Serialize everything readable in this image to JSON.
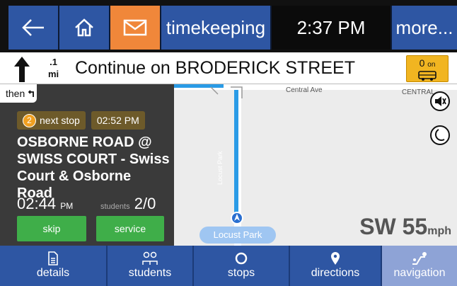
{
  "topbar": {
    "timekeeping": "timekeeping",
    "clock": "2:37 PM",
    "more": "more..."
  },
  "nav": {
    "distance_top": ".1",
    "distance_unit": "mi",
    "instruction": "Continue on BRODERICK STREET",
    "onbus_count": "0",
    "onbus_label": "on"
  },
  "panel": {
    "then": "then",
    "stop_number": "2",
    "next_stop_label": "next stop",
    "next_stop_time": "02:52 PM",
    "stop_name": "OSBORNE ROAD @ SWISS COURT - Swiss Court & Osborne Road",
    "eta_time": "02:44",
    "eta_ampm": "PM",
    "students_label": "students",
    "students_value": "2/0",
    "skip": "skip",
    "service": "service"
  },
  "map": {
    "street_central": "Central Ave",
    "street_central_caps": "CENTRAL",
    "street_locust": "Locust Park",
    "poi": "Locust Park",
    "heading": "SW",
    "speed": "55",
    "speed_unit": "mph"
  },
  "bottom": {
    "details": "details",
    "students": "students",
    "stops": "stops",
    "directions": "directions",
    "navigation": "navigation"
  },
  "colors": {
    "blue": "#2e56a3",
    "orange": "#f0873a",
    "green": "#3fae49",
    "route": "#2a9be6",
    "onbus": "#f1b521",
    "active": "#8ea3d6"
  }
}
